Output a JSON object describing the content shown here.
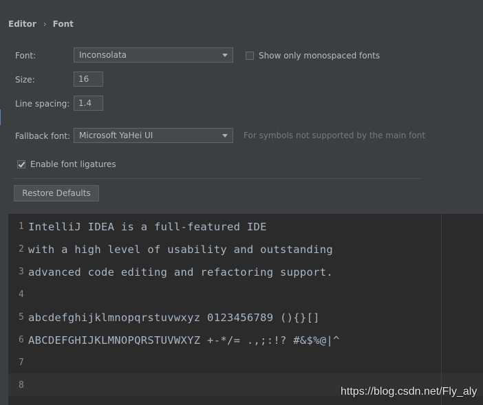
{
  "breadcrumb": {
    "parent": "Editor",
    "separator": "›",
    "current": "Font"
  },
  "font": {
    "label": "Font:",
    "value": "Inconsolata",
    "monospaced_checkbox_label": "Show only monospaced fonts",
    "monospaced_checked": false
  },
  "size": {
    "label": "Size:",
    "value": "16"
  },
  "line_spacing": {
    "label": "Line spacing:",
    "value": "1.4"
  },
  "fallback": {
    "label": "Fallback font:",
    "value": "Microsoft YaHei UI",
    "hint": "For symbols not supported by the main font"
  },
  "ligatures": {
    "label": "Enable font ligatures",
    "checked": true
  },
  "restore_button": "Restore Defaults",
  "preview": {
    "lines": [
      {
        "num": "1",
        "text": "IntelliJ IDEA is a full-featured IDE"
      },
      {
        "num": "2",
        "text": "with a high level of usability and outstanding"
      },
      {
        "num": "3",
        "text": "advanced code editing and refactoring support."
      },
      {
        "num": "4",
        "text": ""
      },
      {
        "num": "5",
        "text": "abcdefghijklmnopqrstuvwxyz 0123456789 (){}[]"
      },
      {
        "num": "6",
        "text": "ABCDEFGHIJKLMNOPQRSTUVWXYZ +-*/= .,;:!? #&$%@|^"
      },
      {
        "num": "7",
        "text": ""
      },
      {
        "num": "8",
        "text": ""
      }
    ]
  },
  "watermark": "https://blog.csdn.net/Fly_aly",
  "colors": {
    "background": "#3c3f41",
    "editor_background": "#2b2b2b",
    "text": "#bbbbbb",
    "code_text": "#a9b7c6"
  }
}
